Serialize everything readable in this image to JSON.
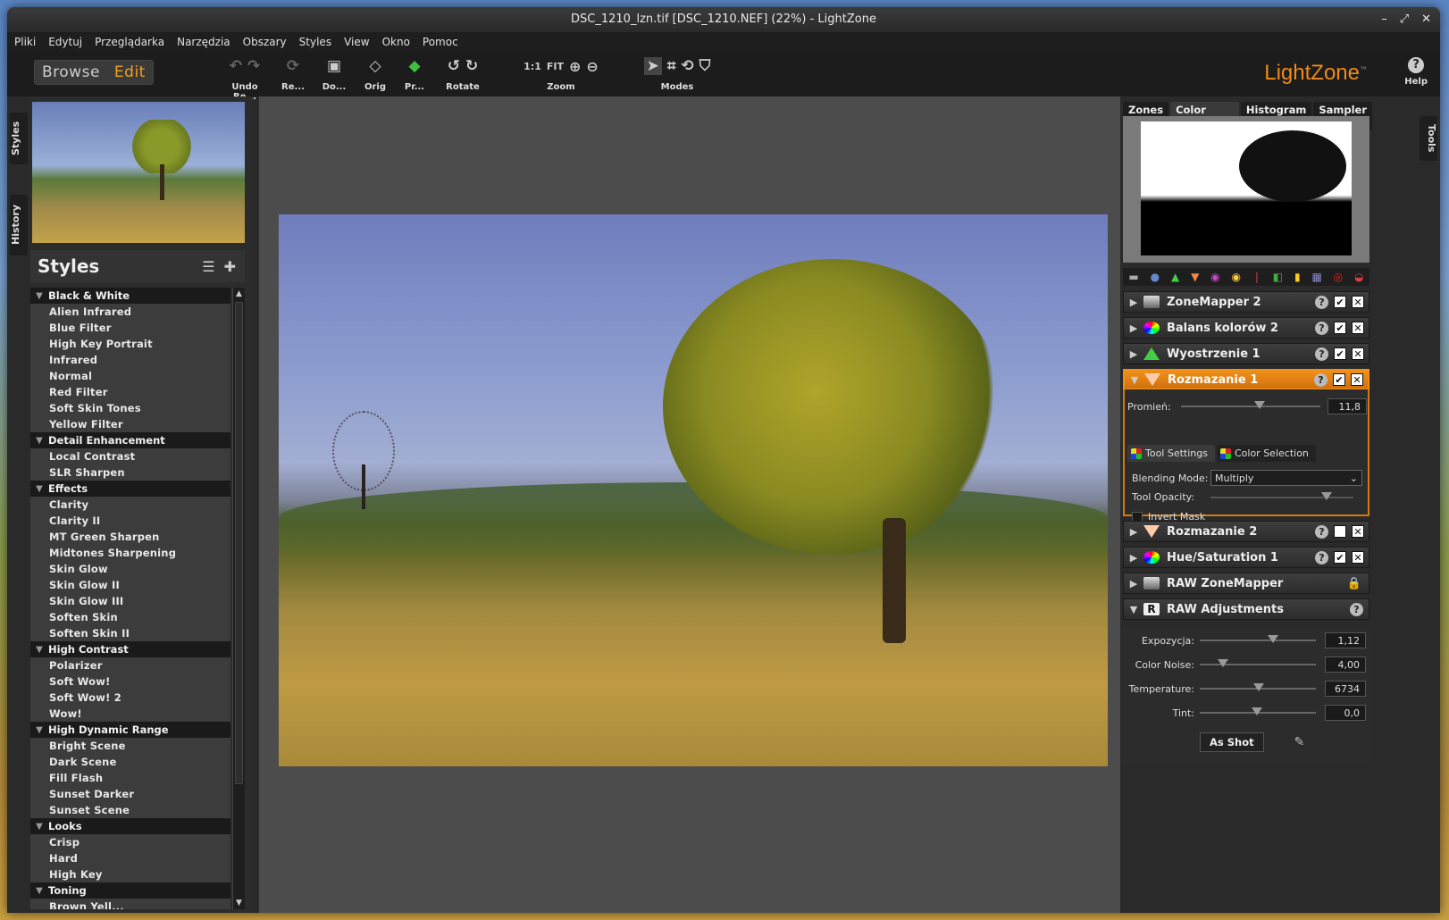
{
  "window": {
    "title": "DSC_1210_lzn.tif [DSC_1210.NEF] (22%) - LightZone",
    "controls": [
      "–",
      "⤢",
      "✕"
    ]
  },
  "menu": [
    "Pliki",
    "Edytuj",
    "Przeglądarka",
    "Narzędzia",
    "Obszary",
    "Styles",
    "View",
    "Okno",
    "Pomoc"
  ],
  "toolbar": {
    "browse": "Browse",
    "edit": "Edit",
    "undo_redo": "Undo Re...",
    "reset": "Re...",
    "done": "Do...",
    "orig": "Orig",
    "print": "Pr...",
    "rotate": "Rotate",
    "zoom": "Zoom",
    "zoom_1_1": "1:1",
    "zoom_fit": "FIT",
    "modes": "Modes",
    "logo": "LightZone",
    "logo_tm": "™",
    "help": "Help",
    "help_icon": "?"
  },
  "left_tabs": [
    "Styles",
    "History"
  ],
  "right_tabs": [
    "Tools"
  ],
  "styles": {
    "title": "Styles",
    "categories": [
      {
        "name": "Black & White",
        "items": [
          "Alien Infrared",
          "Blue Filter",
          "High Key Portrait",
          "Infrared",
          "Normal",
          "Red Filter",
          "Soft Skin Tones",
          "Yellow Filter"
        ]
      },
      {
        "name": "Detail Enhancement",
        "items": [
          "Local Contrast",
          "SLR Sharpen"
        ]
      },
      {
        "name": "Effects",
        "items": [
          "Clarity",
          "Clarity II",
          "MT Green Sharpen",
          "Midtones Sharpening",
          "Skin Glow",
          "Skin Glow II",
          "Skin Glow III",
          "Soften Skin",
          "Soften Skin II"
        ]
      },
      {
        "name": "High Contrast",
        "items": [
          "Polarizer",
          "Soft Wow!",
          "Soft Wow! 2",
          "Wow!"
        ]
      },
      {
        "name": "High Dynamic Range",
        "items": [
          "Bright Scene",
          "Dark Scene",
          "Fill Flash",
          "Sunset Darker",
          "Sunset Scene"
        ]
      },
      {
        "name": "Looks",
        "items": [
          "Crisp",
          "Hard",
          "High Key"
        ]
      },
      {
        "name": "Toning",
        "items": [
          "Brown Yell..."
        ]
      }
    ]
  },
  "right": {
    "tabs": [
      "Zones",
      "Color Mask",
      "Histogram",
      "Sampler"
    ],
    "tools": [
      {
        "name": "ZoneMapper 2",
        "checked": true
      },
      {
        "name": "Balans kolorów 2",
        "checked": true
      },
      {
        "name": "Wyostrzenie 1",
        "checked": true
      },
      {
        "name": "Rozmazanie 1",
        "checked": true
      }
    ],
    "blur": {
      "radius_label": "Promień:",
      "radius_value": "11,8",
      "tab_settings": "Tool Settings",
      "tab_color": "Color Selection",
      "blending_label": "Blending Mode:",
      "blending_value": "Multiply",
      "opacity_label": "Tool Opacity:",
      "invert_label": "Invert Mask"
    },
    "tools2": [
      {
        "name": "Rozmazanie 2",
        "checked": false
      },
      {
        "name": "Hue/Saturation 1",
        "checked": true
      }
    ],
    "raw_zonemapper": "RAW ZoneMapper",
    "raw_adjust": {
      "title": "RAW Adjustments",
      "rows": [
        {
          "label": "Expozycja:",
          "value": "1,12"
        },
        {
          "label": "Color Noise:",
          "value": "4,00"
        },
        {
          "label": "Temperature:",
          "value": "6734"
        },
        {
          "label": "Tint:",
          "value": "0,0"
        }
      ],
      "as_shot": "As Shot"
    }
  }
}
